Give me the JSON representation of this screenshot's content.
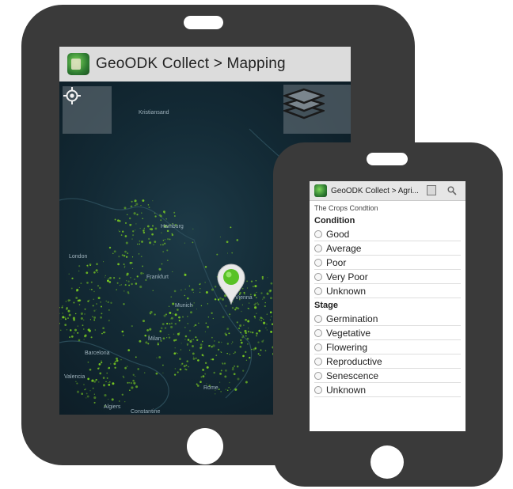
{
  "tablet": {
    "app_title": "GeoODK Collect > Mapping",
    "map_labels": [
      "Kristiansand",
      "Hamburg",
      "London",
      "Frankfurt",
      "Munich",
      "Milan",
      "Barcelona",
      "Valencia",
      "Algiers",
      "Constantine",
      "Rome",
      "Vienna"
    ],
    "icons": {
      "app": "geoodk-app-icon",
      "locate": "my-location-icon",
      "layers": "layers-icon",
      "pin": "map-pin-icon"
    }
  },
  "phone": {
    "app_title": "GeoODK Collect > Agri...",
    "question": "The Crops Condtion",
    "condition": {
      "heading": "Condition",
      "options": [
        "Good",
        "Average",
        "Poor",
        "Very Poor",
        "Unknown"
      ]
    },
    "stage": {
      "heading": "Stage",
      "options": [
        "Germination",
        "Vegetative",
        "Flowering",
        "Reproductive",
        "Senescence",
        "Unknown"
      ]
    },
    "icons": {
      "app": "geoodk-app-icon",
      "save": "save-icon",
      "search": "search-icon"
    }
  },
  "colors": {
    "device_body": "#3a3a3a",
    "map_lights": "#7ed321",
    "pin": "#58c226"
  }
}
